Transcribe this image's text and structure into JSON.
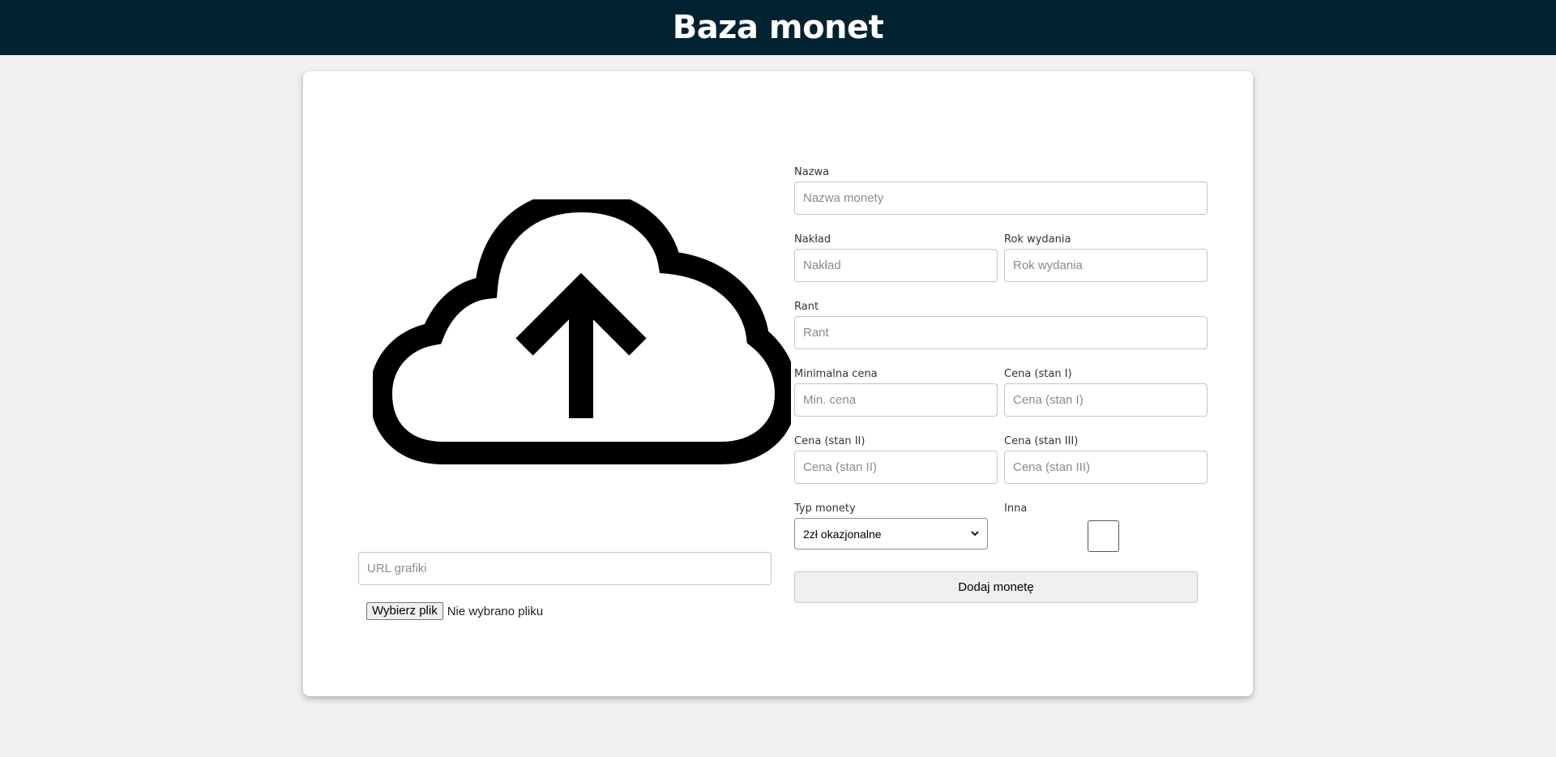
{
  "header": {
    "title": "Baza monet",
    "background": "#012230"
  },
  "image_panel": {
    "icon": "cloud-upload-icon",
    "url_placeholder": "URL grafiki",
    "file_button_label": "Wybierz plik",
    "file_status": "Nie wybrano pliku"
  },
  "form": {
    "name": {
      "label": "Nazwa",
      "placeholder": "Nazwa monety"
    },
    "mintage": {
      "label": "Nakład",
      "placeholder": "Nakład"
    },
    "year": {
      "label": "Rok wydania",
      "placeholder": "Rok wydania"
    },
    "edge": {
      "label": "Rant",
      "placeholder": "Rant"
    },
    "min_price": {
      "label": "Minimalna cena",
      "placeholder": "Min. cena"
    },
    "price_1": {
      "label": "Cena (stan I)",
      "placeholder": "Cena (stan I)"
    },
    "price_2": {
      "label": "Cena (stan II)",
      "placeholder": "Cena (stan II)"
    },
    "price_3": {
      "label": "Cena (stan III)",
      "placeholder": "Cena (stan III)"
    },
    "coin_type": {
      "label": "Typ monety",
      "selected": "2zł okazjonalne"
    },
    "other": {
      "label": "Inna",
      "checked": false
    },
    "submit_label": "Dodaj monetę"
  }
}
